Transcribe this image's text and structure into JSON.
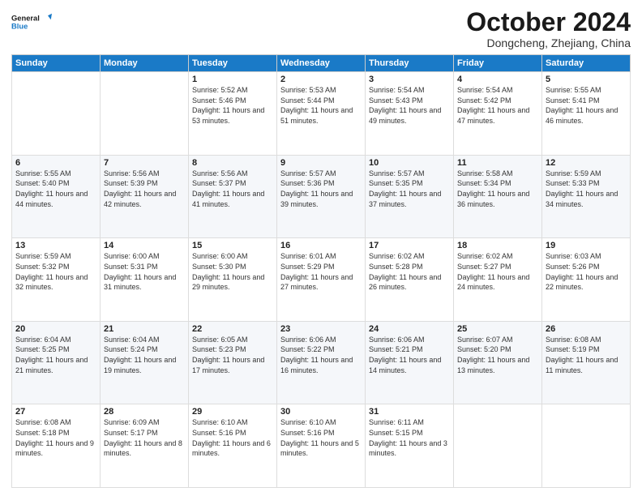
{
  "logo": {
    "line1": "General",
    "line2": "Blue"
  },
  "header": {
    "month": "October 2024",
    "location": "Dongcheng, Zhejiang, China"
  },
  "weekdays": [
    "Sunday",
    "Monday",
    "Tuesday",
    "Wednesday",
    "Thursday",
    "Friday",
    "Saturday"
  ],
  "weeks": [
    [
      {
        "day": "",
        "sunrise": "",
        "sunset": "",
        "daylight": ""
      },
      {
        "day": "",
        "sunrise": "",
        "sunset": "",
        "daylight": ""
      },
      {
        "day": "1",
        "sunrise": "Sunrise: 5:52 AM",
        "sunset": "Sunset: 5:46 PM",
        "daylight": "Daylight: 11 hours and 53 minutes."
      },
      {
        "day": "2",
        "sunrise": "Sunrise: 5:53 AM",
        "sunset": "Sunset: 5:44 PM",
        "daylight": "Daylight: 11 hours and 51 minutes."
      },
      {
        "day": "3",
        "sunrise": "Sunrise: 5:54 AM",
        "sunset": "Sunset: 5:43 PM",
        "daylight": "Daylight: 11 hours and 49 minutes."
      },
      {
        "day": "4",
        "sunrise": "Sunrise: 5:54 AM",
        "sunset": "Sunset: 5:42 PM",
        "daylight": "Daylight: 11 hours and 47 minutes."
      },
      {
        "day": "5",
        "sunrise": "Sunrise: 5:55 AM",
        "sunset": "Sunset: 5:41 PM",
        "daylight": "Daylight: 11 hours and 46 minutes."
      }
    ],
    [
      {
        "day": "6",
        "sunrise": "Sunrise: 5:55 AM",
        "sunset": "Sunset: 5:40 PM",
        "daylight": "Daylight: 11 hours and 44 minutes."
      },
      {
        "day": "7",
        "sunrise": "Sunrise: 5:56 AM",
        "sunset": "Sunset: 5:39 PM",
        "daylight": "Daylight: 11 hours and 42 minutes."
      },
      {
        "day": "8",
        "sunrise": "Sunrise: 5:56 AM",
        "sunset": "Sunset: 5:37 PM",
        "daylight": "Daylight: 11 hours and 41 minutes."
      },
      {
        "day": "9",
        "sunrise": "Sunrise: 5:57 AM",
        "sunset": "Sunset: 5:36 PM",
        "daylight": "Daylight: 11 hours and 39 minutes."
      },
      {
        "day": "10",
        "sunrise": "Sunrise: 5:57 AM",
        "sunset": "Sunset: 5:35 PM",
        "daylight": "Daylight: 11 hours and 37 minutes."
      },
      {
        "day": "11",
        "sunrise": "Sunrise: 5:58 AM",
        "sunset": "Sunset: 5:34 PM",
        "daylight": "Daylight: 11 hours and 36 minutes."
      },
      {
        "day": "12",
        "sunrise": "Sunrise: 5:59 AM",
        "sunset": "Sunset: 5:33 PM",
        "daylight": "Daylight: 11 hours and 34 minutes."
      }
    ],
    [
      {
        "day": "13",
        "sunrise": "Sunrise: 5:59 AM",
        "sunset": "Sunset: 5:32 PM",
        "daylight": "Daylight: 11 hours and 32 minutes."
      },
      {
        "day": "14",
        "sunrise": "Sunrise: 6:00 AM",
        "sunset": "Sunset: 5:31 PM",
        "daylight": "Daylight: 11 hours and 31 minutes."
      },
      {
        "day": "15",
        "sunrise": "Sunrise: 6:00 AM",
        "sunset": "Sunset: 5:30 PM",
        "daylight": "Daylight: 11 hours and 29 minutes."
      },
      {
        "day": "16",
        "sunrise": "Sunrise: 6:01 AM",
        "sunset": "Sunset: 5:29 PM",
        "daylight": "Daylight: 11 hours and 27 minutes."
      },
      {
        "day": "17",
        "sunrise": "Sunrise: 6:02 AM",
        "sunset": "Sunset: 5:28 PM",
        "daylight": "Daylight: 11 hours and 26 minutes."
      },
      {
        "day": "18",
        "sunrise": "Sunrise: 6:02 AM",
        "sunset": "Sunset: 5:27 PM",
        "daylight": "Daylight: 11 hours and 24 minutes."
      },
      {
        "day": "19",
        "sunrise": "Sunrise: 6:03 AM",
        "sunset": "Sunset: 5:26 PM",
        "daylight": "Daylight: 11 hours and 22 minutes."
      }
    ],
    [
      {
        "day": "20",
        "sunrise": "Sunrise: 6:04 AM",
        "sunset": "Sunset: 5:25 PM",
        "daylight": "Daylight: 11 hours and 21 minutes."
      },
      {
        "day": "21",
        "sunrise": "Sunrise: 6:04 AM",
        "sunset": "Sunset: 5:24 PM",
        "daylight": "Daylight: 11 hours and 19 minutes."
      },
      {
        "day": "22",
        "sunrise": "Sunrise: 6:05 AM",
        "sunset": "Sunset: 5:23 PM",
        "daylight": "Daylight: 11 hours and 17 minutes."
      },
      {
        "day": "23",
        "sunrise": "Sunrise: 6:06 AM",
        "sunset": "Sunset: 5:22 PM",
        "daylight": "Daylight: 11 hours and 16 minutes."
      },
      {
        "day": "24",
        "sunrise": "Sunrise: 6:06 AM",
        "sunset": "Sunset: 5:21 PM",
        "daylight": "Daylight: 11 hours and 14 minutes."
      },
      {
        "day": "25",
        "sunrise": "Sunrise: 6:07 AM",
        "sunset": "Sunset: 5:20 PM",
        "daylight": "Daylight: 11 hours and 13 minutes."
      },
      {
        "day": "26",
        "sunrise": "Sunrise: 6:08 AM",
        "sunset": "Sunset: 5:19 PM",
        "daylight": "Daylight: 11 hours and 11 minutes."
      }
    ],
    [
      {
        "day": "27",
        "sunrise": "Sunrise: 6:08 AM",
        "sunset": "Sunset: 5:18 PM",
        "daylight": "Daylight: 11 hours and 9 minutes."
      },
      {
        "day": "28",
        "sunrise": "Sunrise: 6:09 AM",
        "sunset": "Sunset: 5:17 PM",
        "daylight": "Daylight: 11 hours and 8 minutes."
      },
      {
        "day": "29",
        "sunrise": "Sunrise: 6:10 AM",
        "sunset": "Sunset: 5:16 PM",
        "daylight": "Daylight: 11 hours and 6 minutes."
      },
      {
        "day": "30",
        "sunrise": "Sunrise: 6:10 AM",
        "sunset": "Sunset: 5:16 PM",
        "daylight": "Daylight: 11 hours and 5 minutes."
      },
      {
        "day": "31",
        "sunrise": "Sunrise: 6:11 AM",
        "sunset": "Sunset: 5:15 PM",
        "daylight": "Daylight: 11 hours and 3 minutes."
      },
      {
        "day": "",
        "sunrise": "",
        "sunset": "",
        "daylight": ""
      },
      {
        "day": "",
        "sunrise": "",
        "sunset": "",
        "daylight": ""
      }
    ]
  ]
}
